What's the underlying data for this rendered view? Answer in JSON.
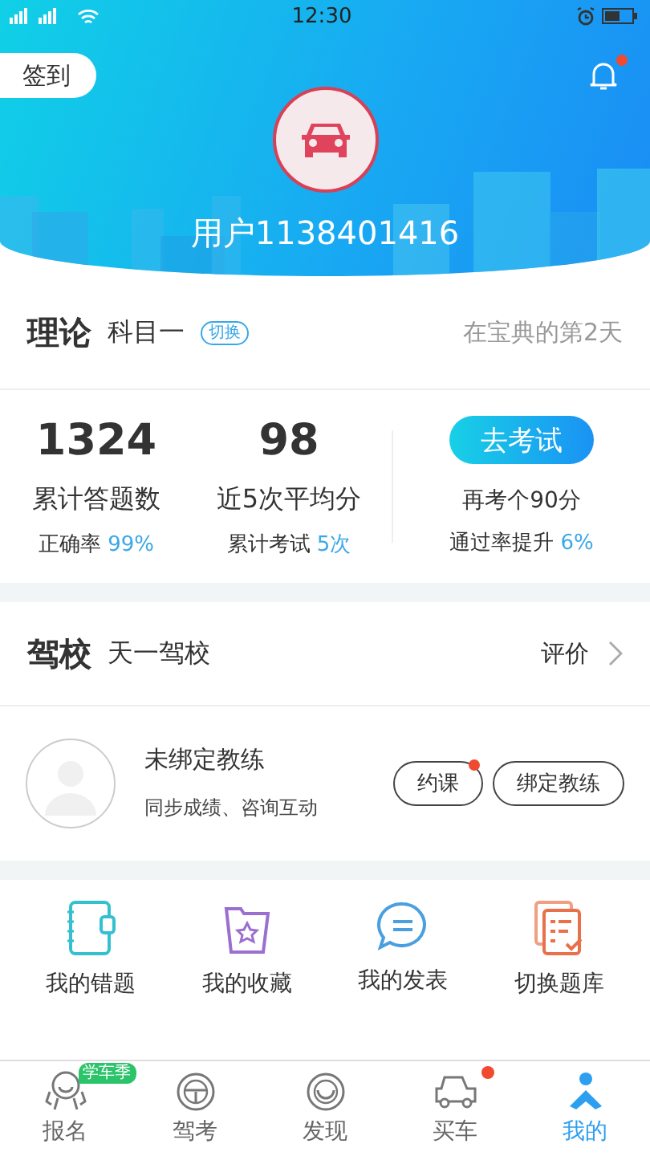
{
  "status_bar": {
    "time": "12:30"
  },
  "header": {
    "checkin_label": "签到",
    "notification_badge": true,
    "username": "用户1138401416"
  },
  "theory": {
    "title": "理论",
    "subject": "科目一",
    "switch_label": "切换",
    "days_text": "在宝典的第2天"
  },
  "stats": [
    {
      "value": "1324",
      "label": "累计答题数",
      "sub_label": "正确率",
      "sub_value": "99%"
    },
    {
      "value": "98",
      "label": "近5次平均分",
      "sub_label": "累计考试",
      "sub_value": "5次"
    }
  ],
  "exam": {
    "button": "去考试",
    "line1": "再考个90分",
    "line2_label": "通过率提升",
    "line2_value": "6%"
  },
  "school": {
    "title": "驾校",
    "name": "天一驾校",
    "review_label": "评价"
  },
  "coach": {
    "name": "未绑定教练",
    "description": "同步成绩、咨询互动",
    "buttons": [
      {
        "label": "约课",
        "badge": true
      },
      {
        "label": "绑定教练",
        "badge": false
      }
    ]
  },
  "shortcuts": [
    {
      "kind": "notebook",
      "label": "我的错题"
    },
    {
      "kind": "favorites",
      "label": "我的收藏"
    },
    {
      "kind": "chat",
      "label": "我的发表"
    },
    {
      "kind": "list",
      "label": "切换题库"
    }
  ],
  "tabs": [
    {
      "kind": "signup",
      "label": "报名",
      "badge_text": "学车季",
      "dot": false,
      "selected": false
    },
    {
      "kind": "wheel",
      "label": "驾考",
      "dot": false,
      "selected": false
    },
    {
      "kind": "discover",
      "label": "发现",
      "dot": false,
      "selected": false
    },
    {
      "kind": "car",
      "label": "买车",
      "dot": true,
      "selected": false
    },
    {
      "kind": "mine",
      "label": "我的",
      "dot": false,
      "selected": true
    }
  ]
}
